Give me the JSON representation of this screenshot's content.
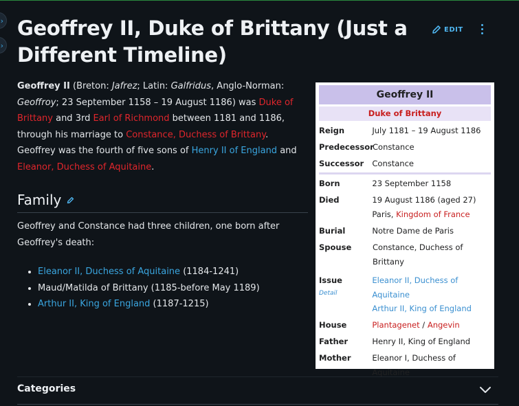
{
  "page": {
    "title": "Geoffrey II, Duke of Brittany (Just a Different Timeline)",
    "edit_label": "EDIT"
  },
  "intro": {
    "name": "Geoffrey II",
    "t1": " (Breton: ",
    "breton": "Jafrez",
    "t2": "; Latin: ",
    "latin": "Galfridus",
    "t3": ", Anglo-Norman: ",
    "norman": "Geoffroy",
    "t4": "; 23 September 1158 – 19 August 1186) was ",
    "link_duke": "Duke of Brittany",
    "t5": " and 3rd ",
    "link_earl": "Earl of Richmond",
    "t6": " between 1181 and 1186, through his marriage to ",
    "link_constance": "Constance, Duchess of Brittany",
    "t7": ". Geoffrey was the fourth of five sons of ",
    "link_henry": "Henry II of England",
    "t8": " and ",
    "link_eleanor": "Eleanor, Duchess of Aquitaine",
    "t9": "."
  },
  "family": {
    "heading": "Family",
    "text": "Geoffrey and Constance had three children, one born after Geoffrey's death:",
    "children": [
      {
        "link": "Eleanor II, Duchess of Aquitaine",
        "rest": " (1184-1241)"
      },
      {
        "link": "",
        "rest": "Maud/Matilda of Brittany (1185-before May 1189)"
      },
      {
        "link": "Arthur II, King of England",
        "rest": " (1187-1215)"
      }
    ]
  },
  "infobox": {
    "title": "Geoffrey II",
    "subtitle": "Duke of Brittany",
    "reign_label": "Reign",
    "reign": "July 1181 – 19 August 1186",
    "predecessor_label": "Predecessor",
    "predecessor": "Constance",
    "successor_label": "Successor",
    "successor": "Constance",
    "born_label": "Born",
    "born": "23 September 1158",
    "died_label": "Died",
    "died": "19 August 1186 (aged 27)",
    "died_place1": "Paris, ",
    "died_place2": "Kingdom of France",
    "burial_label": "Burial",
    "burial": "Notre Dame de Paris",
    "spouse_label": "Spouse",
    "spouse": "Constance, Duchess of Brittany",
    "issue_label": "Issue",
    "issue_detail": "Detail",
    "issue1": "Eleanor II, Duchess of Aquitaine",
    "issue2": "Arthur II, King of England",
    "house_label": "House",
    "house1": "Plantagenet",
    "house_sep": " / ",
    "house2": "Angevin",
    "father_label": "Father",
    "father": "Henry II, King of England",
    "mother_label": "Mother",
    "mother": "Eleanor I, Duchess of Aquitaine"
  },
  "footer": {
    "categories": "Categories"
  },
  "colors": {
    "background": "#0f1419",
    "link_red": "#e0262c",
    "link_blue": "#3aa6e0",
    "infobox_header": "#c9c0ea"
  }
}
